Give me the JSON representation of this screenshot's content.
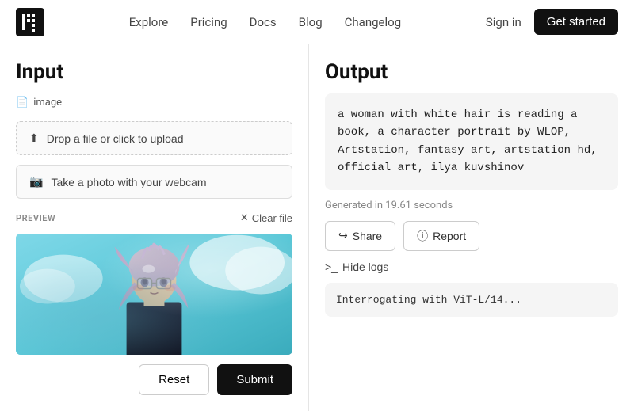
{
  "navbar": {
    "logo_alt": "Replicate logo",
    "links": [
      {
        "label": "Explore",
        "href": "#",
        "active": false
      },
      {
        "label": "Pricing",
        "href": "#",
        "active": false
      },
      {
        "label": "Docs",
        "href": "#",
        "active": false
      },
      {
        "label": "Blog",
        "href": "#",
        "active": false
      },
      {
        "label": "Changelog",
        "href": "#",
        "active": false
      }
    ],
    "signin_label": "Sign in",
    "get_started_label": "Get started"
  },
  "input_panel": {
    "title": "Input",
    "image_label": "image",
    "upload_label": "Drop a file or click to upload",
    "webcam_label": "Take a photo with your webcam",
    "preview_label": "PREVIEW",
    "clear_file_label": "Clear file",
    "reset_label": "Reset",
    "submit_label": "Submit"
  },
  "output_panel": {
    "title": "Output",
    "output_text": "a woman with white hair is reading a\nbook, a character portrait by WLOP,\nArtstation, fantasy art, artstation hd,\nofficial art, ilya kuvshinov",
    "generated_time": "Generated in 19.61 seconds",
    "share_label": "Share",
    "report_label": "Report",
    "hide_logs_label": "Hide logs",
    "logs_text": "Interrogating with ViT-L/14..."
  }
}
